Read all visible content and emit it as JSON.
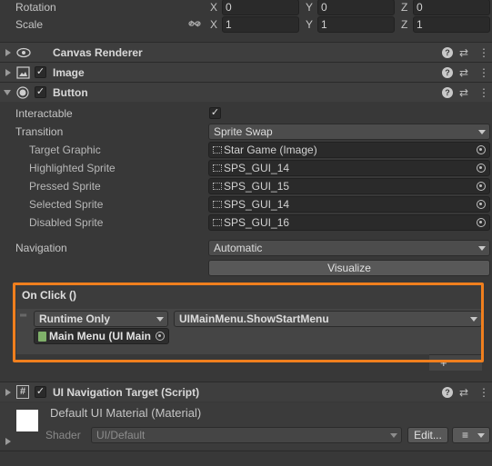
{
  "transform": {
    "rotation_label": "Rotation",
    "scale_label": "Scale",
    "rotation": {
      "x": "0",
      "y": "0",
      "z": "0"
    },
    "scale": {
      "x": "1",
      "y": "1",
      "z": "1"
    },
    "axis_x": "X",
    "axis_y": "Y",
    "axis_z": "Z"
  },
  "components": {
    "canvas_renderer": "Canvas Renderer",
    "image": "Image",
    "button": "Button"
  },
  "button": {
    "interactable_label": "Interactable",
    "interactable_checked": "✓",
    "transition_label": "Transition",
    "transition_value": "Sprite Swap",
    "target_graphic_label": "Target Graphic",
    "target_graphic_value": "Star Game (Image)",
    "highlighted_label": "Highlighted Sprite",
    "highlighted_value": "SPS_GUI_14",
    "pressed_label": "Pressed Sprite",
    "pressed_value": "SPS_GUI_15",
    "selected_label": "Selected Sprite",
    "selected_value": "SPS_GUI_14",
    "disabled_label": "Disabled Sprite",
    "disabled_value": "SPS_GUI_16",
    "navigation_label": "Navigation",
    "navigation_value": "Automatic",
    "visualize_label": "Visualize"
  },
  "on_click": {
    "title": "On Click ()",
    "runtime_value": "Runtime Only",
    "function_value": "UIMainMenu.ShowStartMenu",
    "object_value": "Main Menu (UI Main",
    "plus": "+"
  },
  "nav_target": {
    "title": "UI Navigation Target (Script)"
  },
  "material": {
    "name": "Default UI Material (Material)",
    "shader_label": "Shader",
    "shader_value": "UI/Default",
    "edit_label": "Edit...",
    "list_icon": "≡"
  },
  "colors": {
    "highlight_border": "#f07f1e",
    "panel_bg": "#383838",
    "header_bg": "#3e3e3e"
  }
}
